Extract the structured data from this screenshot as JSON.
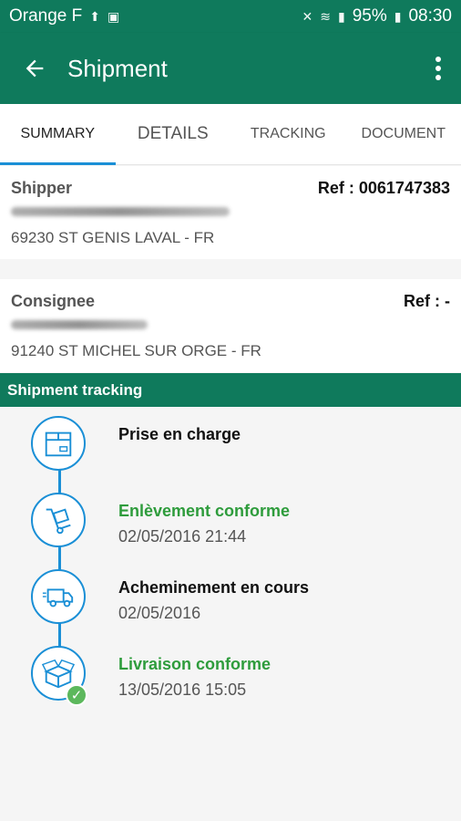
{
  "status_bar": {
    "carrier": "Orange F",
    "battery": "95%",
    "time": "08:30"
  },
  "app_bar": {
    "title": "Shipment"
  },
  "tabs": [
    {
      "label": "SUMMARY",
      "active": true
    },
    {
      "label": "DETAILS",
      "active": false
    },
    {
      "label": "TRACKING",
      "active": false
    },
    {
      "label": "DOCUMENT",
      "active": false
    }
  ],
  "shipper": {
    "label": "Shipper",
    "ref": "Ref : 0061747383",
    "address": "69230 ST GENIS LAVAL - FR"
  },
  "consignee": {
    "label": "Consignee",
    "ref": "Ref : -",
    "address": "91240 ST MICHEL SUR ORGE - FR"
  },
  "tracking_section": {
    "title": "Shipment tracking",
    "steps": [
      {
        "title": "Prise en charge",
        "date": "",
        "status": "pending",
        "icon": "box-icon"
      },
      {
        "title": "Enlèvement conforme",
        "date": "02/05/2016 21:44",
        "status": "done",
        "icon": "hand-truck-icon"
      },
      {
        "title": "Acheminement en cours",
        "date": "02/05/2016",
        "status": "in-progress",
        "icon": "delivery-truck-icon"
      },
      {
        "title": "Livraison conforme",
        "date": "13/05/2016 15:05",
        "status": "done",
        "icon": "open-box-icon"
      }
    ]
  },
  "colors": {
    "primary": "#0f7a5c",
    "accent_blue": "#1a8fd6",
    "success_green": "#2e9c3c"
  }
}
